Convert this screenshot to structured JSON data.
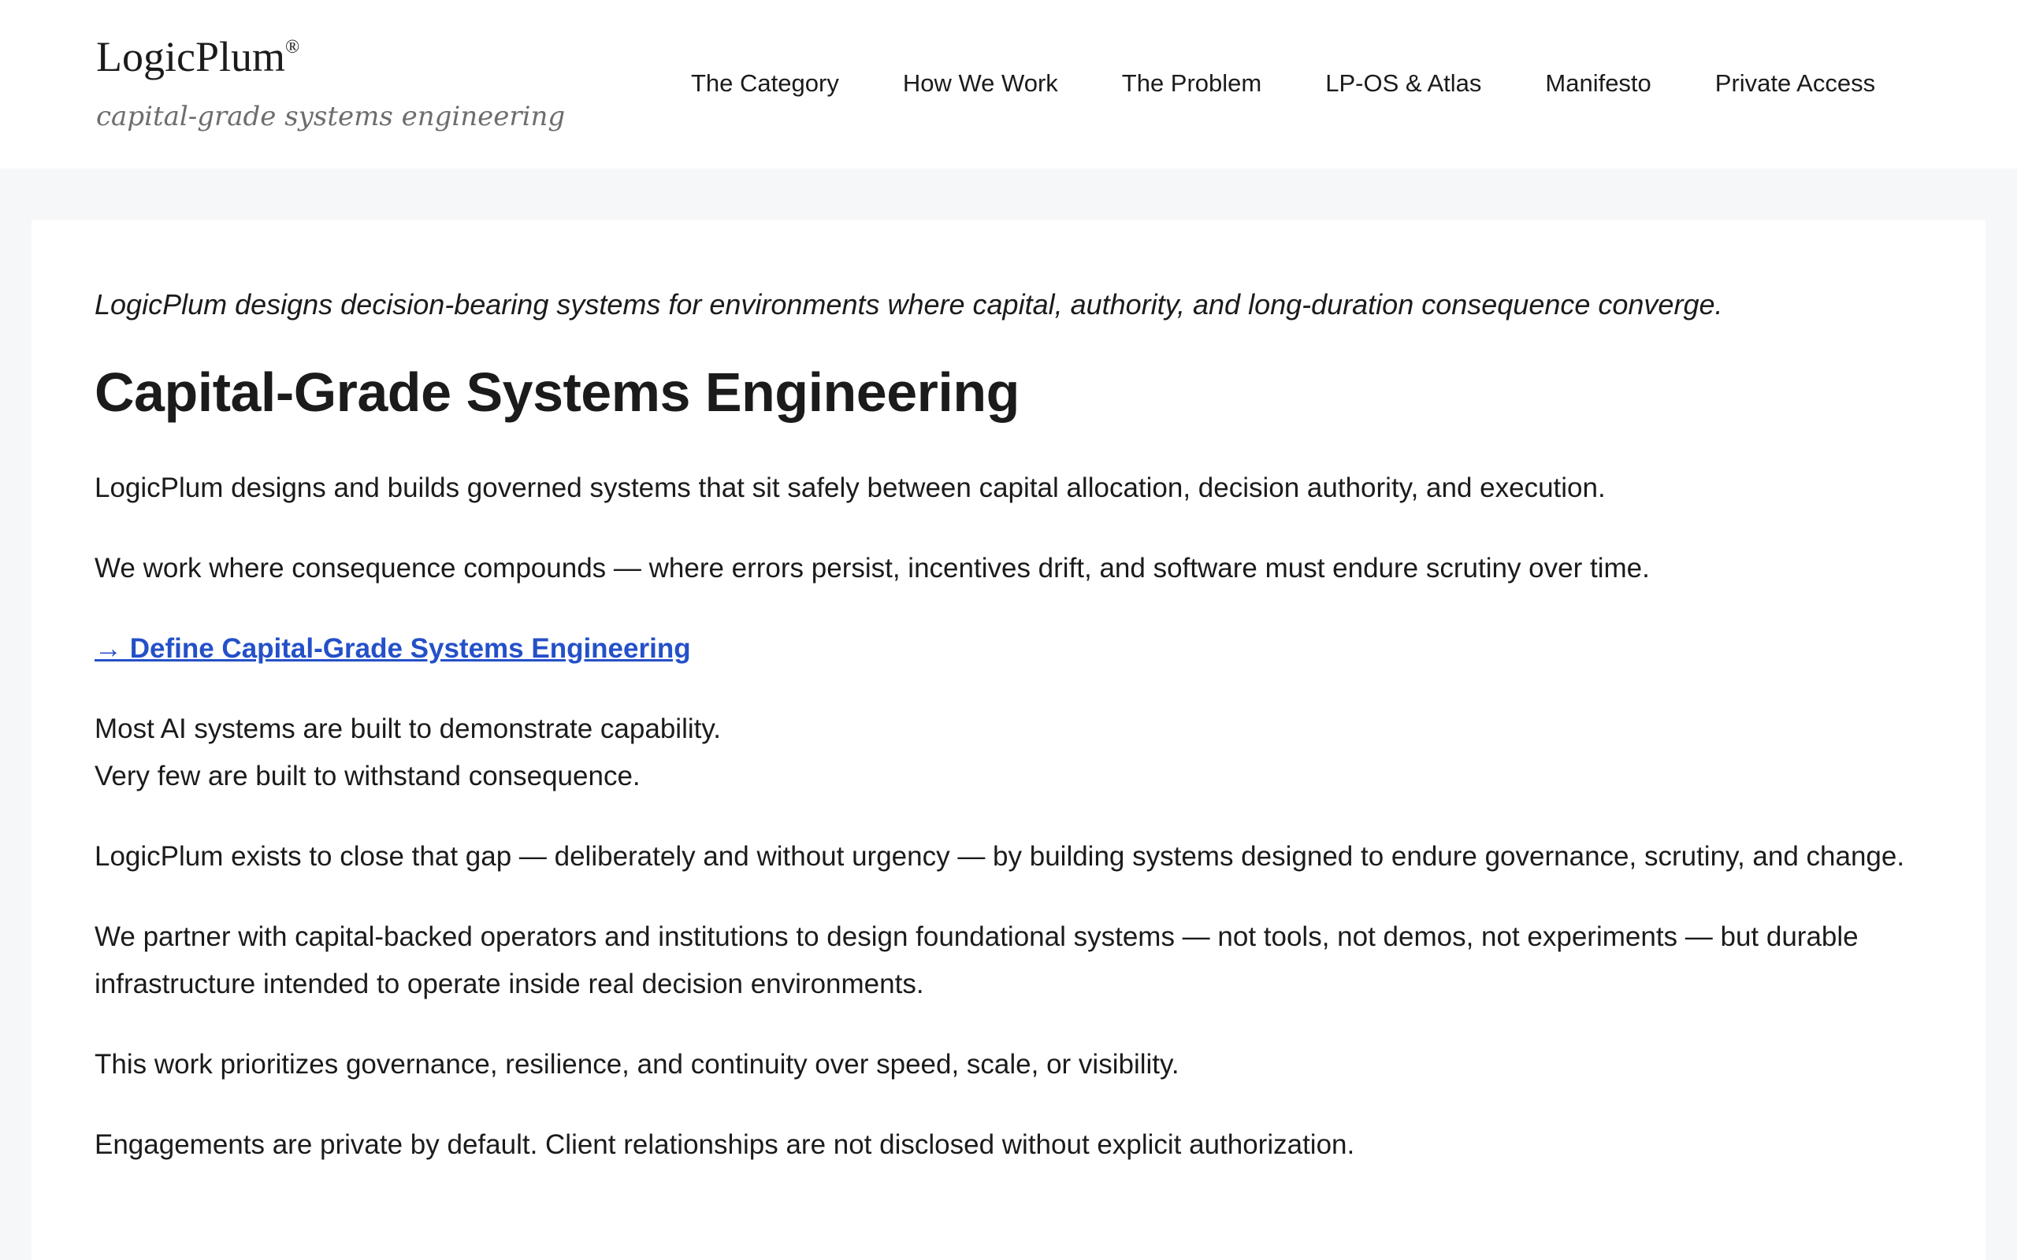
{
  "brand": {
    "name": "LogicPlum",
    "mark": "®",
    "tagline": "capital-grade systems engineering"
  },
  "nav": {
    "items": [
      {
        "label": "The Category"
      },
      {
        "label": "How We Work"
      },
      {
        "label": "The Problem"
      },
      {
        "label": "LP-OS & Atlas"
      },
      {
        "label": "Manifesto"
      },
      {
        "label": "Private Access"
      }
    ]
  },
  "main": {
    "intro": "LogicPlum designs decision-bearing systems for environments where capital, authority, and long-duration consequence converge.",
    "title": "Capital-Grade Systems Engineering",
    "p1": "LogicPlum designs and builds governed systems that sit safely between capital allocation, decision authority, and execution.",
    "p2": "We work where consequence compounds — where errors persist, incentives drift, and software must endure scrutiny over time.",
    "cta": "→ Define Capital-Grade Systems Engineering",
    "p3_line1": "Most AI systems are built to demonstrate capability.",
    "p3_line2": "Very few are built to withstand consequence.",
    "p4": "LogicPlum exists to close that gap — deliberately and without urgency — by building systems designed to endure governance, scrutiny, and change.",
    "p5": "We partner with capital-backed operators and institutions to design foundational systems — not tools, not demos, not experiments — but durable infrastructure intended to operate inside real decision environments.",
    "p6": "This work prioritizes governance, resilience, and continuity over speed, scale, or visibility.",
    "p7": "Engagements are private by default. Client relationships are not disclosed without explicit authorization."
  }
}
